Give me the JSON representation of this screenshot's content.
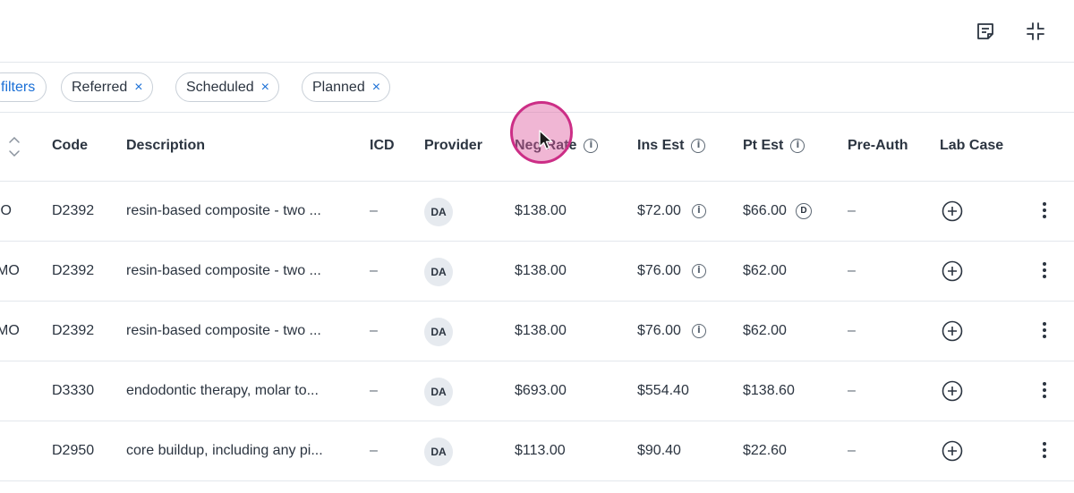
{
  "toolbar": {
    "note_icon": "note-icon",
    "collapse_icon": "collapse-icon"
  },
  "filters": {
    "link_label": "filters",
    "chips": [
      {
        "label": "Referred"
      },
      {
        "label": "Scheduled"
      },
      {
        "label": "Planned"
      }
    ],
    "remove_glyph": "×"
  },
  "table": {
    "columns": {
      "code": "Code",
      "description": "Description",
      "icd": "ICD",
      "provider": "Provider",
      "neg_rate": "Neg Rate",
      "ins_est": "Ins Est",
      "pt_est": "Pt Est",
      "pre_auth": "Pre-Auth",
      "lab_case": "Lab Case"
    },
    "rows": [
      {
        "surface": "IO",
        "code": "D2392",
        "description": "resin-based composite - two ...",
        "icd": "–",
        "provider": "DA",
        "neg_rate": "$138.00",
        "ins_est": "$72.00",
        "pt_est": "$66.00",
        "pt_badge": "D",
        "pre_auth": "–"
      },
      {
        "surface": "MO",
        "code": "D2392",
        "description": "resin-based composite - two ...",
        "icd": "–",
        "provider": "DA",
        "neg_rate": "$138.00",
        "ins_est": "$76.00",
        "pt_est": "$62.00",
        "pre_auth": "–"
      },
      {
        "surface": "MO",
        "code": "D2392",
        "description": "resin-based composite - two ...",
        "icd": "–",
        "provider": "DA",
        "neg_rate": "$138.00",
        "ins_est": "$76.00",
        "pt_est": "$62.00",
        "pre_auth": "–"
      },
      {
        "surface": "",
        "code": "D3330",
        "description": "endodontic therapy, molar to...",
        "icd": "–",
        "provider": "DA",
        "neg_rate": "$693.00",
        "ins_est": "$554.40",
        "pt_est": "$138.60",
        "pre_auth": "–"
      },
      {
        "surface": "",
        "code": "D2950",
        "description": "core buildup, including any pi...",
        "icd": "–",
        "provider": "DA",
        "neg_rate": "$113.00",
        "ins_est": "$90.40",
        "pt_est": "$22.60",
        "pre_auth": "–"
      }
    ]
  },
  "colors": {
    "accent": "#1a6fd6",
    "cursor_ring": "#cc2e86"
  }
}
